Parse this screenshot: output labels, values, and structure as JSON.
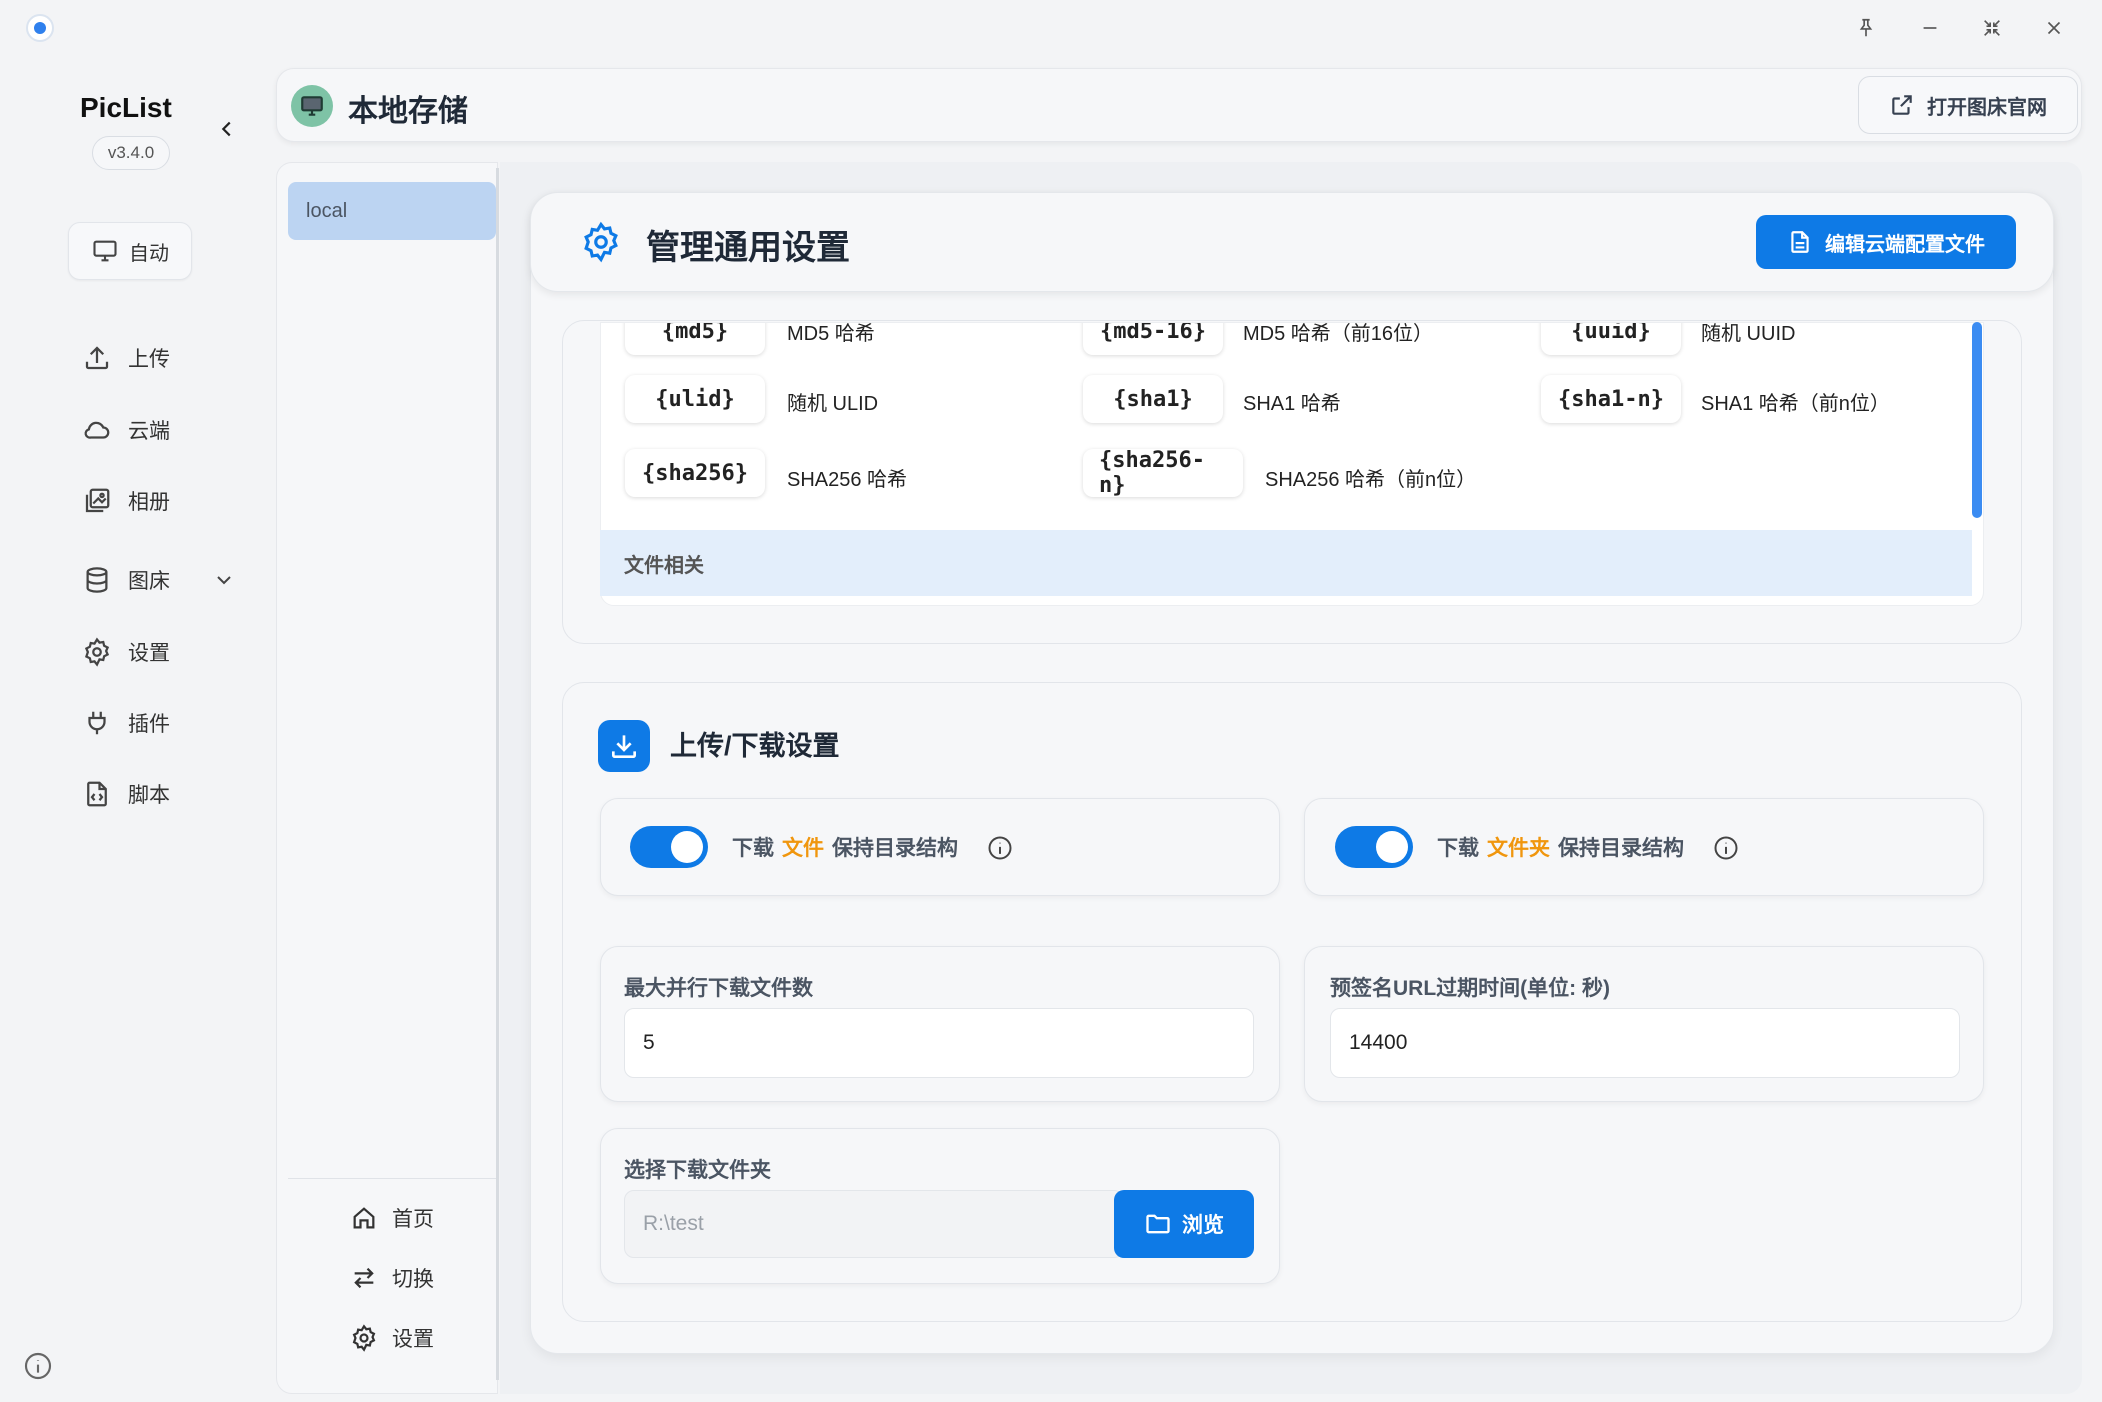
{
  "app": {
    "name": "PicList",
    "version": "v3.4.0"
  },
  "sidebar": {
    "auto_label": "自动",
    "items": [
      {
        "label": "上传",
        "icon": "upload-icon"
      },
      {
        "label": "云端",
        "icon": "cloud-icon"
      },
      {
        "label": "相册",
        "icon": "gallery-icon"
      },
      {
        "label": "图床",
        "icon": "database-icon"
      },
      {
        "label": "设置",
        "icon": "gear-icon"
      },
      {
        "label": "插件",
        "icon": "plug-icon"
      },
      {
        "label": "脚本",
        "icon": "script-icon"
      }
    ]
  },
  "header": {
    "title": "本地存储",
    "open_site_label": "打开图床官网"
  },
  "list_panel": {
    "items": [
      "local"
    ],
    "bottom": [
      {
        "label": "首页",
        "icon": "home-icon"
      },
      {
        "label": "切换",
        "icon": "switch-icon"
      },
      {
        "label": "设置",
        "icon": "gear-icon"
      }
    ]
  },
  "settings": {
    "title": "管理通用设置",
    "edit_cloud_label": "编辑云端配置文件",
    "variables": [
      {
        "var": "{md5}",
        "desc": "MD5 哈希"
      },
      {
        "var": "{md5-16}",
        "desc": "MD5 哈希（前16位）"
      },
      {
        "var": "{uuid}",
        "desc": "随机 UUID"
      },
      {
        "var": "{ulid}",
        "desc": "随机 ULID"
      },
      {
        "var": "{sha1}",
        "desc": "SHA1 哈希"
      },
      {
        "var": "{sha1-n}",
        "desc": "SHA1 哈希（前n位）"
      },
      {
        "var": "{sha256}",
        "desc": "SHA256 哈希"
      },
      {
        "var": "{sha256-n}",
        "desc": "SHA256 哈希（前n位）"
      }
    ],
    "group_label": "文件相关"
  },
  "upload_download": {
    "title": "上传/下载设置",
    "toggle1": {
      "pre": "下载",
      "hl": "文件",
      "post": "保持目录结构",
      "on": true
    },
    "toggle2": {
      "pre": "下载",
      "hl": "文件夹",
      "post": "保持目录结构",
      "on": true
    },
    "max_parallel_label": "最大并行下载文件数",
    "max_parallel_value": "5",
    "presign_label": "预签名URL过期时间(单位: 秒)",
    "presign_value": "14400",
    "folder_label": "选择下载文件夹",
    "folder_value": "R:\\test",
    "browse_label": "浏览"
  },
  "colors": {
    "accent": "#0e7ae6",
    "highlight": "#f0960e",
    "selected_bg": "#bcd4f2"
  }
}
